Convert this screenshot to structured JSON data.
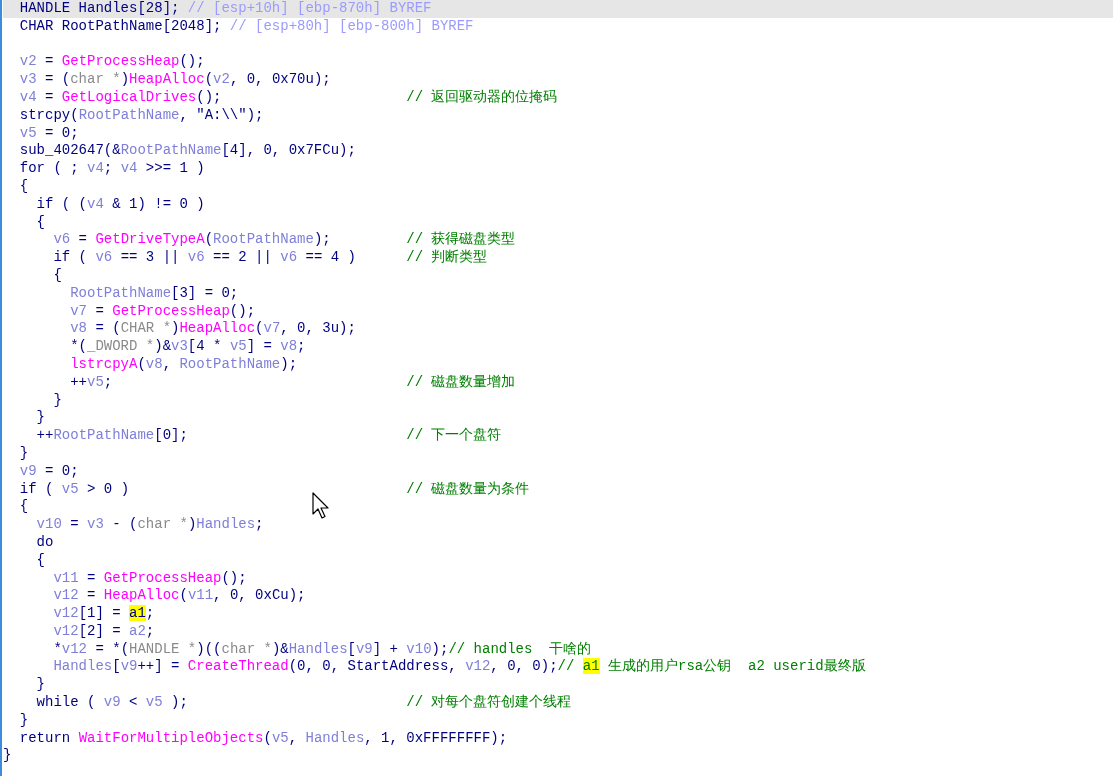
{
  "lines": [
    {
      "selected": true,
      "code": [
        {
          "text": "  HANDLE Handles[28]; ",
          "kind": "plain"
        },
        {
          "text": "// [esp+10h] [ebp-870h] BYREF",
          "kind": "meta"
        }
      ]
    },
    {
      "selected": false,
      "code": [
        {
          "text": "  CHAR RootPathName[2048]; ",
          "kind": "plain"
        },
        {
          "text": "// [esp+80h] [ebp-800h] BYREF",
          "kind": "meta"
        }
      ]
    },
    {
      "selected": false
    },
    {
      "selected": false,
      "code": [
        {
          "text": "  v2",
          "kind": "var"
        },
        {
          "text": " = ",
          "kind": "plain"
        },
        {
          "text": "GetProcessHeap",
          "kind": "func"
        },
        {
          "text": "();",
          "kind": "plain"
        }
      ]
    },
    {
      "selected": false,
      "code": [
        {
          "text": "  v3",
          "kind": "var"
        },
        {
          "text": " = (",
          "kind": "plain"
        },
        {
          "text": "char *",
          "kind": "type"
        },
        {
          "text": ")",
          "kind": "plain"
        },
        {
          "text": "HeapAlloc",
          "kind": "func"
        },
        {
          "text": "(",
          "kind": "plain"
        },
        {
          "text": "v2",
          "kind": "var"
        },
        {
          "text": ", 0, 0x70u);",
          "kind": "plain"
        }
      ]
    },
    {
      "selected": false,
      "code": [
        {
          "text": "  v4",
          "kind": "var"
        },
        {
          "text": " = ",
          "kind": "plain"
        },
        {
          "text": "GetLogicalDrives",
          "kind": "func"
        },
        {
          "text": "();",
          "kind": "plain"
        }
      ],
      "comment": [
        {
          "text": "// 返回驱动器的位掩码",
          "kind": "comment"
        }
      ]
    },
    {
      "selected": false,
      "code": [
        {
          "text": "  strcpy(",
          "kind": "plain"
        },
        {
          "text": "RootPathName",
          "kind": "var"
        },
        {
          "text": ", \"A:\\\\\");",
          "kind": "plain"
        }
      ]
    },
    {
      "selected": false,
      "code": [
        {
          "text": "  v5",
          "kind": "var"
        },
        {
          "text": " = 0;",
          "kind": "plain"
        }
      ]
    },
    {
      "selected": false,
      "code": [
        {
          "text": "  sub_402647(&",
          "kind": "plain"
        },
        {
          "text": "RootPathName",
          "kind": "var"
        },
        {
          "text": "[4], 0, 0x7FCu);",
          "kind": "plain"
        }
      ]
    },
    {
      "selected": false,
      "code": [
        {
          "text": "  for ( ; ",
          "kind": "plain"
        },
        {
          "text": "v4",
          "kind": "var"
        },
        {
          "text": "; ",
          "kind": "plain"
        },
        {
          "text": "v4",
          "kind": "var"
        },
        {
          "text": " >>= 1 )",
          "kind": "plain"
        }
      ]
    },
    {
      "selected": false,
      "code": [
        {
          "text": "  {",
          "kind": "plain"
        }
      ]
    },
    {
      "selected": false,
      "code": [
        {
          "text": "    if ( (",
          "kind": "plain"
        },
        {
          "text": "v4",
          "kind": "var"
        },
        {
          "text": " & 1) != 0 )",
          "kind": "plain"
        }
      ]
    },
    {
      "selected": false,
      "code": [
        {
          "text": "    {",
          "kind": "plain"
        }
      ]
    },
    {
      "selected": false,
      "code": [
        {
          "text": "      v6",
          "kind": "var"
        },
        {
          "text": " = ",
          "kind": "plain"
        },
        {
          "text": "GetDriveTypeA",
          "kind": "func"
        },
        {
          "text": "(",
          "kind": "plain"
        },
        {
          "text": "RootPathName",
          "kind": "var"
        },
        {
          "text": ");",
          "kind": "plain"
        }
      ],
      "comment": [
        {
          "text": "// 获得磁盘类型",
          "kind": "comment"
        }
      ]
    },
    {
      "selected": false,
      "code": [
        {
          "text": "      if ( ",
          "kind": "plain"
        },
        {
          "text": "v6",
          "kind": "var"
        },
        {
          "text": " == 3 || ",
          "kind": "plain"
        },
        {
          "text": "v6",
          "kind": "var"
        },
        {
          "text": " == 2 || ",
          "kind": "plain"
        },
        {
          "text": "v6",
          "kind": "var"
        },
        {
          "text": " == 4 )",
          "kind": "plain"
        }
      ],
      "comment": [
        {
          "text": "// 判断类型",
          "kind": "comment"
        }
      ]
    },
    {
      "selected": false,
      "code": [
        {
          "text": "      {",
          "kind": "plain"
        }
      ]
    },
    {
      "selected": false,
      "code": [
        {
          "text": "        RootPathName",
          "kind": "var"
        },
        {
          "text": "[3] = 0;",
          "kind": "plain"
        }
      ]
    },
    {
      "selected": false,
      "code": [
        {
          "text": "        v7",
          "kind": "var"
        },
        {
          "text": " = ",
          "kind": "plain"
        },
        {
          "text": "GetProcessHeap",
          "kind": "func"
        },
        {
          "text": "();",
          "kind": "plain"
        }
      ]
    },
    {
      "selected": false,
      "code": [
        {
          "text": "        v8",
          "kind": "var"
        },
        {
          "text": " = (",
          "kind": "plain"
        },
        {
          "text": "CHAR *",
          "kind": "type"
        },
        {
          "text": ")",
          "kind": "plain"
        },
        {
          "text": "HeapAlloc",
          "kind": "func"
        },
        {
          "text": "(",
          "kind": "plain"
        },
        {
          "text": "v7",
          "kind": "var"
        },
        {
          "text": ", 0, 3u);",
          "kind": "plain"
        }
      ]
    },
    {
      "selected": false,
      "code": [
        {
          "text": "        *(",
          "kind": "plain"
        },
        {
          "text": "_DWORD *",
          "kind": "type"
        },
        {
          "text": ")&",
          "kind": "plain"
        },
        {
          "text": "v3",
          "kind": "var"
        },
        {
          "text": "[4 * ",
          "kind": "plain"
        },
        {
          "text": "v5",
          "kind": "var"
        },
        {
          "text": "] = ",
          "kind": "plain"
        },
        {
          "text": "v8",
          "kind": "var"
        },
        {
          "text": ";",
          "kind": "plain"
        }
      ]
    },
    {
      "selected": false,
      "code": [
        {
          "text": "        lstrcpyA",
          "kind": "func"
        },
        {
          "text": "(",
          "kind": "plain"
        },
        {
          "text": "v8",
          "kind": "var"
        },
        {
          "text": ", ",
          "kind": "plain"
        },
        {
          "text": "RootPathName",
          "kind": "var"
        },
        {
          "text": ");",
          "kind": "plain"
        }
      ]
    },
    {
      "selected": false,
      "code": [
        {
          "text": "        ++",
          "kind": "plain"
        },
        {
          "text": "v5",
          "kind": "var"
        },
        {
          "text": ";",
          "kind": "plain"
        }
      ],
      "comment": [
        {
          "text": "// 磁盘数量增加",
          "kind": "comment"
        }
      ]
    },
    {
      "selected": false,
      "code": [
        {
          "text": "      }",
          "kind": "plain"
        }
      ]
    },
    {
      "selected": false,
      "code": [
        {
          "text": "    }",
          "kind": "plain"
        }
      ]
    },
    {
      "selected": false,
      "code": [
        {
          "text": "    ++",
          "kind": "plain"
        },
        {
          "text": "RootPathName",
          "kind": "var"
        },
        {
          "text": "[0];",
          "kind": "plain"
        }
      ],
      "comment": [
        {
          "text": "// 下一个盘符",
          "kind": "comment"
        }
      ]
    },
    {
      "selected": false,
      "code": [
        {
          "text": "  }",
          "kind": "plain"
        }
      ]
    },
    {
      "selected": false,
      "code": [
        {
          "text": "  v9",
          "kind": "var"
        },
        {
          "text": " = 0;",
          "kind": "plain"
        }
      ]
    },
    {
      "selected": false,
      "code": [
        {
          "text": "  if ( ",
          "kind": "plain"
        },
        {
          "text": "v5",
          "kind": "var"
        },
        {
          "text": " > 0 )",
          "kind": "plain"
        }
      ],
      "comment": [
        {
          "text": "// 磁盘数量为条件",
          "kind": "comment"
        }
      ]
    },
    {
      "selected": false,
      "code": [
        {
          "text": "  {",
          "kind": "plain"
        }
      ]
    },
    {
      "selected": false,
      "code": [
        {
          "text": "    v10",
          "kind": "var"
        },
        {
          "text": " = ",
          "kind": "plain"
        },
        {
          "text": "v3",
          "kind": "var"
        },
        {
          "text": " - (",
          "kind": "plain"
        },
        {
          "text": "char *",
          "kind": "type"
        },
        {
          "text": ")",
          "kind": "plain"
        },
        {
          "text": "Handles",
          "kind": "var"
        },
        {
          "text": ";",
          "kind": "plain"
        }
      ]
    },
    {
      "selected": false,
      "code": [
        {
          "text": "    do",
          "kind": "plain"
        }
      ]
    },
    {
      "selected": false,
      "code": [
        {
          "text": "    {",
          "kind": "plain"
        }
      ]
    },
    {
      "selected": false,
      "code": [
        {
          "text": "      v11",
          "kind": "var"
        },
        {
          "text": " = ",
          "kind": "plain"
        },
        {
          "text": "GetProcessHeap",
          "kind": "func"
        },
        {
          "text": "();",
          "kind": "plain"
        }
      ]
    },
    {
      "selected": false,
      "code": [
        {
          "text": "      v12",
          "kind": "var"
        },
        {
          "text": " = ",
          "kind": "plain"
        },
        {
          "text": "HeapAlloc",
          "kind": "func"
        },
        {
          "text": "(",
          "kind": "plain"
        },
        {
          "text": "v11",
          "kind": "var"
        },
        {
          "text": ", 0, 0xCu);",
          "kind": "plain"
        }
      ]
    },
    {
      "selected": false,
      "code": [
        {
          "text": "      v12",
          "kind": "var"
        },
        {
          "text": "[1] = ",
          "kind": "plain"
        },
        {
          "text": "a1",
          "kind": "mark"
        },
        {
          "text": ";",
          "kind": "plain"
        }
      ]
    },
    {
      "selected": false,
      "code": [
        {
          "text": "      v12",
          "kind": "var"
        },
        {
          "text": "[2] = ",
          "kind": "plain"
        },
        {
          "text": "a2",
          "kind": "var"
        },
        {
          "text": ";",
          "kind": "plain"
        }
      ]
    },
    {
      "selected": false,
      "code": [
        {
          "text": "      *",
          "kind": "plain"
        },
        {
          "text": "v12",
          "kind": "var"
        },
        {
          "text": " = *(",
          "kind": "plain"
        },
        {
          "text": "HANDLE *",
          "kind": "type"
        },
        {
          "text": ")((",
          "kind": "plain"
        },
        {
          "text": "char *",
          "kind": "type"
        },
        {
          "text": ")&",
          "kind": "plain"
        },
        {
          "text": "Handles",
          "kind": "var"
        },
        {
          "text": "[",
          "kind": "plain"
        },
        {
          "text": "v9",
          "kind": "var"
        },
        {
          "text": "] + ",
          "kind": "plain"
        },
        {
          "text": "v10",
          "kind": "var"
        },
        {
          "text": ");",
          "kind": "plain"
        }
      ],
      "comment": [
        {
          "text": "// handles  干啥的",
          "kind": "comment"
        }
      ]
    },
    {
      "selected": false,
      "code": [
        {
          "text": "      Handles",
          "kind": "var"
        },
        {
          "text": "[",
          "kind": "plain"
        },
        {
          "text": "v9",
          "kind": "var"
        },
        {
          "text": "++] = ",
          "kind": "plain"
        },
        {
          "text": "CreateThread",
          "kind": "func"
        },
        {
          "text": "(0, 0, StartAddress, ",
          "kind": "plain"
        },
        {
          "text": "v12",
          "kind": "var"
        },
        {
          "text": ", 0, 0);",
          "kind": "plain"
        }
      ],
      "comment": [
        {
          "text": "// ",
          "kind": "comment"
        },
        {
          "text": "a1",
          "kind": "mark"
        },
        {
          "text": " 生成的用户rsa公钥  a2 userid最终版",
          "kind": "comment"
        }
      ]
    },
    {
      "selected": false,
      "code": [
        {
          "text": "    }",
          "kind": "plain"
        }
      ]
    },
    {
      "selected": false,
      "code": [
        {
          "text": "    while ( ",
          "kind": "plain"
        },
        {
          "text": "v9",
          "kind": "var"
        },
        {
          "text": " < ",
          "kind": "plain"
        },
        {
          "text": "v5",
          "kind": "var"
        },
        {
          "text": " );",
          "kind": "plain"
        }
      ],
      "comment": [
        {
          "text": "// 对每个盘符创建个线程",
          "kind": "comment"
        }
      ]
    },
    {
      "selected": false,
      "code": [
        {
          "text": "  }",
          "kind": "plain"
        }
      ]
    },
    {
      "selected": false,
      "code": [
        {
          "text": "  return ",
          "kind": "plain"
        },
        {
          "text": "WaitForMultipleObjects",
          "kind": "func"
        },
        {
          "text": "(",
          "kind": "plain"
        },
        {
          "text": "v5",
          "kind": "var"
        },
        {
          "text": ", ",
          "kind": "plain"
        },
        {
          "text": "Handles",
          "kind": "var"
        },
        {
          "text": ", 1, 0xFFFFFFFF);",
          "kind": "plain"
        }
      ]
    },
    {
      "selected": false,
      "code": [
        {
          "text": "}",
          "kind": "plain"
        }
      ]
    }
  ]
}
